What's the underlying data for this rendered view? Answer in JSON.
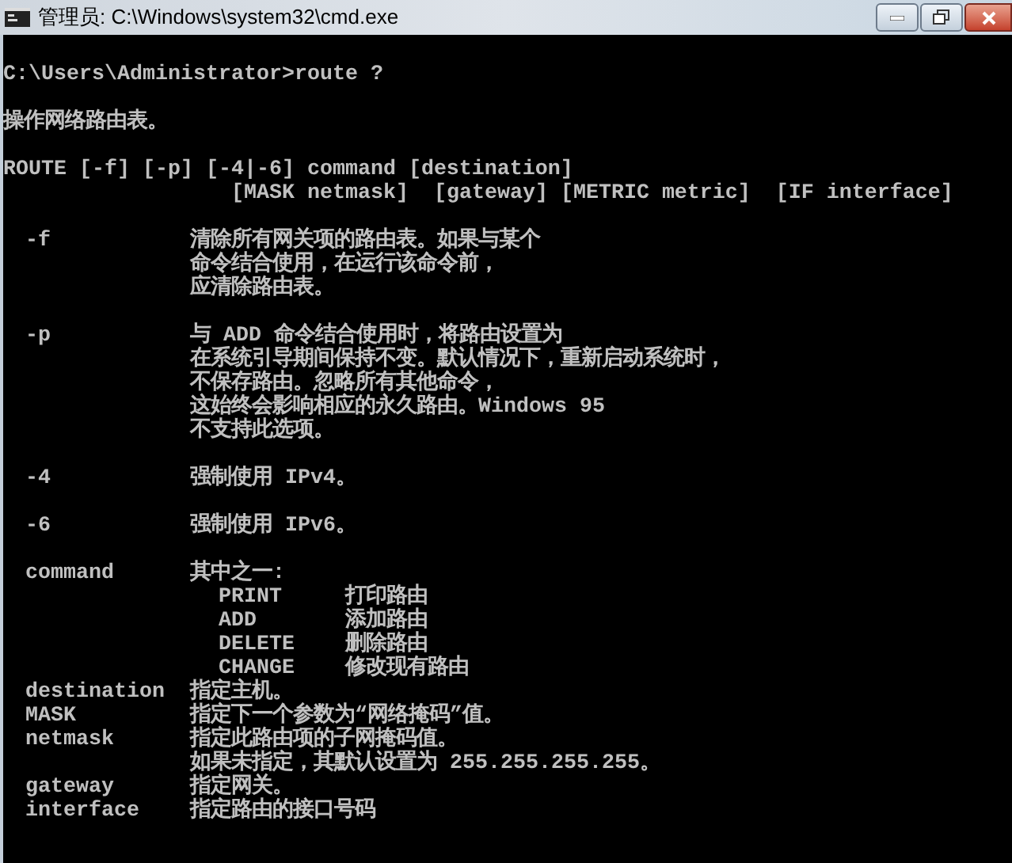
{
  "window": {
    "title": "管理员: C:\\Windows\\system32\\cmd.exe"
  },
  "console": {
    "lines": [
      {
        "kind": "blank"
      },
      {
        "kind": "text",
        "text": "C:\\Users\\Administrator>route ?"
      },
      {
        "kind": "blank"
      },
      {
        "kind": "text",
        "text": "操作网络路由表。"
      },
      {
        "kind": "blank"
      },
      {
        "kind": "text",
        "text": "ROUTE [-f] [-p] [-4|-6] command [destination]"
      },
      {
        "kind": "continuation",
        "text": "[MASK netmask]  [gateway] [METRIC metric]  [IF interface]"
      },
      {
        "kind": "blank"
      },
      {
        "kind": "entry",
        "term": "-f",
        "desc": "清除所有网关项的路由表。如果与某个"
      },
      {
        "kind": "entry",
        "desc": "命令结合使用，在运行该命令前，"
      },
      {
        "kind": "entry",
        "desc": "应清除路由表。"
      },
      {
        "kind": "blank"
      },
      {
        "kind": "entry",
        "term": "-p",
        "desc": "与 ADD 命令结合使用时，将路由设置为"
      },
      {
        "kind": "entry",
        "desc": "在系统引导期间保持不变。默认情况下，重新启动系统时，"
      },
      {
        "kind": "entry",
        "desc": "不保存路由。忽略所有其他命令，"
      },
      {
        "kind": "entry",
        "desc": "这始终会影响相应的永久路由。Windows 95"
      },
      {
        "kind": "entry",
        "desc": "不支持此选项。"
      },
      {
        "kind": "blank"
      },
      {
        "kind": "entry",
        "term": "-4",
        "desc": "强制使用 IPv4。"
      },
      {
        "kind": "blank"
      },
      {
        "kind": "entry",
        "term": "-6",
        "desc": "强制使用 IPv6。"
      },
      {
        "kind": "blank"
      },
      {
        "kind": "entry",
        "term": "command",
        "desc": "其中之一:"
      },
      {
        "kind": "subentry",
        "term": "PRINT",
        "desc": "打印路由"
      },
      {
        "kind": "subentry",
        "term": "ADD",
        "desc": "添加路由"
      },
      {
        "kind": "subentry",
        "term": "DELETE",
        "desc": "删除路由"
      },
      {
        "kind": "subentry",
        "term": "CHANGE",
        "desc": "修改现有路由"
      },
      {
        "kind": "entry",
        "term": "destination",
        "desc": "指定主机。"
      },
      {
        "kind": "entry",
        "term": "MASK",
        "desc": "指定下一个参数为“网络掩码”值。"
      },
      {
        "kind": "entry",
        "term": "netmask",
        "desc": "指定此路由项的子网掩码值。"
      },
      {
        "kind": "entry",
        "desc": "如果未指定，其默认设置为 255.255.255.255。"
      },
      {
        "kind": "entry",
        "term": "gateway",
        "desc": "指定网关。"
      },
      {
        "kind": "entry",
        "term": "interface",
        "desc": "指定路由的接口号码"
      }
    ]
  }
}
